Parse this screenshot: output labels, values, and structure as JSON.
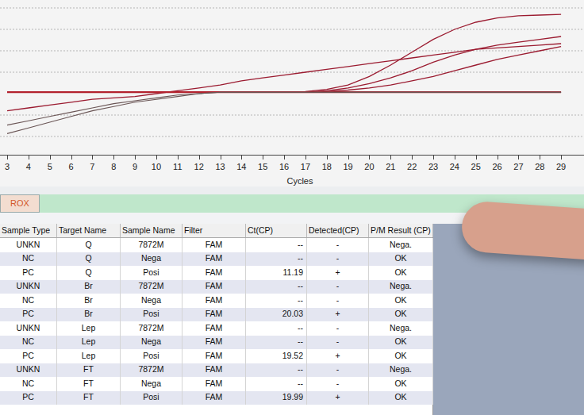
{
  "chart": {
    "x_axis": {
      "title": "Cycles",
      "ticks": [
        "3",
        "4",
        "5",
        "6",
        "7",
        "8",
        "9",
        "10",
        "11",
        "12",
        "13",
        "14",
        "15",
        "16",
        "17",
        "18",
        "19",
        "20",
        "21",
        "22",
        "23",
        "24",
        "25",
        "26",
        "27",
        "28",
        "29"
      ]
    },
    "series": [
      {
        "kind": "amplification",
        "values": [
          28,
          30,
          32,
          34,
          36,
          37,
          38,
          40,
          42,
          44,
          46,
          49,
          51,
          53,
          55,
          57,
          59,
          61,
          63,
          65,
          67,
          69,
          71,
          72,
          73,
          74,
          75
        ]
      },
      {
        "kind": "amplification",
        "values": [
          41,
          41,
          41,
          41,
          41,
          41,
          41,
          41,
          41,
          41,
          41,
          41,
          41,
          41,
          41.5,
          43,
          46,
          52,
          60,
          69,
          78,
          85,
          90,
          93,
          94.5,
          95,
          95.5
        ]
      },
      {
        "kind": "amplification",
        "values": [
          41,
          41,
          41,
          41,
          41,
          41,
          41,
          41,
          41,
          41,
          41,
          41,
          41,
          41,
          41,
          42,
          44,
          47,
          51,
          56,
          62,
          67,
          71,
          74,
          76,
          78,
          80
        ]
      },
      {
        "kind": "amplification",
        "values": [
          41,
          41,
          41,
          41,
          41,
          41,
          41,
          41,
          41,
          41,
          41,
          41,
          41,
          41,
          41,
          41.5,
          42.5,
          44,
          46,
          49,
          52,
          56,
          60,
          64,
          67,
          70,
          73
        ]
      },
      {
        "kind": "baseline",
        "values": [
          41,
          41,
          41,
          41,
          41,
          41,
          41,
          41,
          41,
          41,
          41,
          41,
          41,
          41,
          41,
          41,
          41,
          41,
          41,
          41,
          41,
          41,
          41,
          41,
          41,
          41,
          41
        ]
      },
      {
        "kind": "drift",
        "values": [
          18,
          21,
          24,
          27,
          30,
          33,
          35,
          37,
          39,
          40,
          41,
          41,
          41,
          41,
          41,
          41,
          41,
          41,
          41,
          41,
          41,
          41,
          41,
          41,
          41,
          41,
          41
        ]
      },
      {
        "kind": "drift",
        "values": [
          12,
          16,
          20,
          24,
          28,
          31,
          34,
          36,
          38,
          40,
          41,
          41,
          41,
          41,
          41,
          41,
          41,
          41,
          41,
          41,
          41,
          41,
          41,
          41,
          41,
          41,
          41
        ]
      }
    ]
  },
  "channel_tab": {
    "label": "ROX",
    "selected": true
  },
  "table": {
    "columns": [
      "Sample Type",
      "Target Name",
      "Sample Name",
      "Filter",
      "Ct(CP)",
      "Detected(CP)",
      "P/M Result (CP)"
    ],
    "rows": [
      [
        "UNKN",
        "Q",
        "7872M",
        "FAM",
        "--",
        "-",
        "Nega."
      ],
      [
        "NC",
        "Q",
        "Nega",
        "FAM",
        "--",
        "-",
        "OK"
      ],
      [
        "PC",
        "Q",
        "Posi",
        "FAM",
        "11.19",
        "+",
        "OK"
      ],
      [
        "UNKN",
        "Br",
        "7872M",
        "FAM",
        "--",
        "-",
        "Nega."
      ],
      [
        "NC",
        "Br",
        "Nega",
        "FAM",
        "--",
        "-",
        "OK"
      ],
      [
        "PC",
        "Br",
        "Posi",
        "FAM",
        "20.03",
        "+",
        "OK"
      ],
      [
        "UNKN",
        "Lep",
        "7872M",
        "FAM",
        "--",
        "-",
        "Nega."
      ],
      [
        "NC",
        "Lep",
        "Nega",
        "FAM",
        "--",
        "-",
        "OK"
      ],
      [
        "PC",
        "Lep",
        "Posi",
        "FAM",
        "19.52",
        "+",
        "OK"
      ],
      [
        "UNKN",
        "FT",
        "7872M",
        "FAM",
        "--",
        "-",
        "Nega."
      ],
      [
        "NC",
        "FT",
        "Nega",
        "FAM",
        "--",
        "-",
        "OK"
      ],
      [
        "PC",
        "FT",
        "Posi",
        "FAM",
        "19.99",
        "+",
        "OK"
      ]
    ]
  }
}
